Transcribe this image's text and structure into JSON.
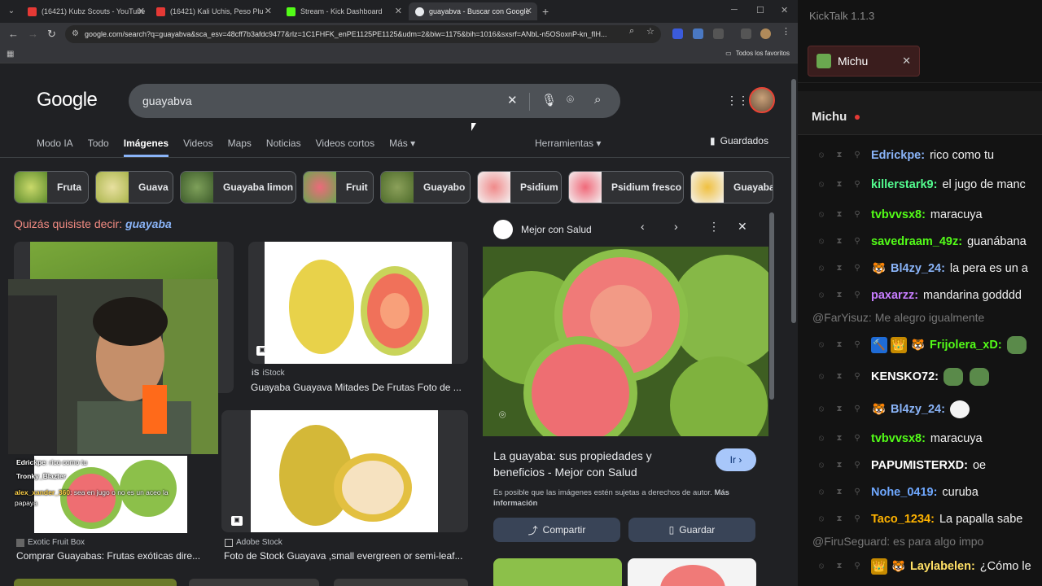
{
  "browser": {
    "tabs": [
      {
        "title": "(16421) Kubz Scouts - YouTube",
        "favicon_color": "#e53935"
      },
      {
        "title": "(16421) Kali Uchis, Peso Plu",
        "favicon_color": "#e53935"
      },
      {
        "title": "Stream - Kick Dashboard",
        "favicon_color": "#53fc18"
      },
      {
        "title": "guayabva - Buscar con Google",
        "favicon_color": "#e8eaed"
      }
    ],
    "url": "google.com/search?q=guayabva&sca_esv=48cff7b3afdc9477&rlz=1C1FHFK_enPE1125PE1125&udm=2&biw=1175&bih=1016&sxsrf=ANbL-n5OSoxnP-kn_fIH...",
    "all_favorites": "Todos los favoritos"
  },
  "google": {
    "logo": "Google",
    "query": "guayabva",
    "tabs": [
      "Modo IA",
      "Todo",
      "Imágenes",
      "Videos",
      "Maps",
      "Noticias",
      "Videos cortos",
      "Más"
    ],
    "tools": "Herramientas",
    "saved": "Guardados",
    "chips": [
      "Fruta",
      "Guava",
      "Guayaba limon",
      "Fruit",
      "Guayabo",
      "Psidium",
      "Psidium fresco",
      "Guayaba"
    ],
    "did_you_mean_prefix": "Quizás quisiste decir:",
    "did_you_mean": "guayaba",
    "results": [
      {
        "source": "iStock",
        "source_icon": "iS",
        "title": "Guayaba Guayava Mitades De Frutas Foto de ..."
      },
      {
        "source": "Exotic Fruit Box",
        "title": "Comprar Guayabas: Frutas exóticas dire..."
      },
      {
        "source": "Adobe Stock",
        "title": "Foto de Stock Guayava ,small evergreen or semi-leaf..."
      }
    ],
    "panel": {
      "source": "Mejor con Salud",
      "title": "La guayaba: sus propiedades y beneficios - Mejor con Salud",
      "visit": "Ir",
      "note": "Es posible que las imágenes estén sujetas a derechos de autor.",
      "note_more": "Más información",
      "share": "Compartir",
      "save": "Guardar"
    }
  },
  "overlay": {
    "lines": [
      {
        "user": "Edrickpe",
        "text": ": rico como tu"
      },
      {
        "user": "Tronky_Blazter",
        "text": ""
      },
      {
        "user": "alex_xander_360",
        "text": ": sea en jugo o no es un aceo la"
      },
      {
        "user": "",
        "text": "papaya"
      }
    ]
  },
  "kicktalk": {
    "title": "KickTalk 1.1.3",
    "tab": "Michu",
    "channel": "Michu",
    "messages": [
      {
        "kind": "msg",
        "user": "Edrickpe",
        "color": "#8ab4f8",
        "text": "rico como tu"
      },
      {
        "kind": "msg",
        "user": "killerstark9",
        "color": "#53fc8f",
        "text": "el jugo de manc"
      },
      {
        "kind": "msg",
        "user": "tvbvvsx8",
        "color": "#53fc18",
        "text": "maracuya"
      },
      {
        "kind": "msg",
        "user": "savedraam_49z",
        "color": "#53fc18",
        "text": "guanábana"
      },
      {
        "kind": "msg",
        "user": "Bl4zy_24",
        "color": "#8ab4f8",
        "text": "la pera es un a",
        "badges": [
          "🐯"
        ]
      },
      {
        "kind": "msg",
        "user": "paxarzz",
        "color": "#c77dff",
        "text": "mandarina godddd"
      },
      {
        "kind": "reply",
        "text": "@FarYisuz: Me alegro igualmente"
      },
      {
        "kind": "msg",
        "user": "Frijolera_xD",
        "color": "#53fc18",
        "text": "",
        "badges": [
          "🔨",
          "👑",
          "🐯"
        ]
      },
      {
        "kind": "msg",
        "user": "KENSKO72",
        "color": "#ffffff",
        "text": ""
      },
      {
        "kind": "msg",
        "user": "Bl4zy_24",
        "color": "#8ab4f8",
        "text": "",
        "badges": [
          "🐯"
        ]
      },
      {
        "kind": "msg",
        "user": "tvbvvsx8",
        "color": "#53fc18",
        "text": "maracuya"
      },
      {
        "kind": "msg",
        "user": "PAPUMISTERXD",
        "color": "#ffffff",
        "text": "oe"
      },
      {
        "kind": "msg",
        "user": "Nohe_0419",
        "color": "#6fa8ff",
        "text": "curuba"
      },
      {
        "kind": "msg",
        "user": "Taco_1234",
        "color": "#ffb300",
        "text": "La papalla sabe"
      },
      {
        "kind": "reply",
        "text": "@FiruSeguard: es para algo impo"
      },
      {
        "kind": "msg",
        "user": "Laylabelen",
        "color": "#ffe066",
        "text": "¿Cómo le",
        "badges": [
          "👑",
          "🐯"
        ]
      }
    ]
  }
}
